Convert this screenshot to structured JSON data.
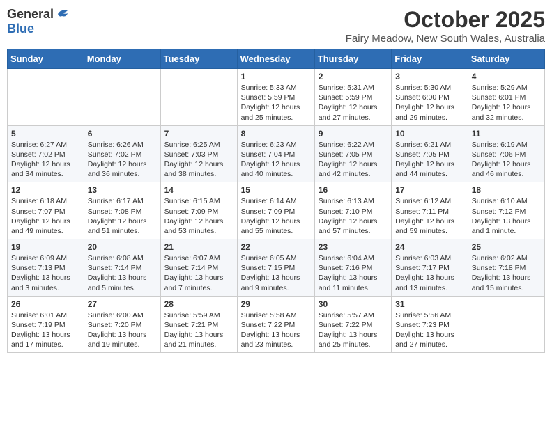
{
  "header": {
    "logo_general": "General",
    "logo_blue": "Blue",
    "month": "October 2025",
    "location": "Fairy Meadow, New South Wales, Australia"
  },
  "days_of_week": [
    "Sunday",
    "Monday",
    "Tuesday",
    "Wednesday",
    "Thursday",
    "Friday",
    "Saturday"
  ],
  "weeks": [
    [
      {
        "day": "",
        "info": ""
      },
      {
        "day": "",
        "info": ""
      },
      {
        "day": "",
        "info": ""
      },
      {
        "day": "1",
        "info": "Sunrise: 5:33 AM\nSunset: 5:59 PM\nDaylight: 12 hours\nand 25 minutes."
      },
      {
        "day": "2",
        "info": "Sunrise: 5:31 AM\nSunset: 5:59 PM\nDaylight: 12 hours\nand 27 minutes."
      },
      {
        "day": "3",
        "info": "Sunrise: 5:30 AM\nSunset: 6:00 PM\nDaylight: 12 hours\nand 29 minutes."
      },
      {
        "day": "4",
        "info": "Sunrise: 5:29 AM\nSunset: 6:01 PM\nDaylight: 12 hours\nand 32 minutes."
      }
    ],
    [
      {
        "day": "5",
        "info": "Sunrise: 6:27 AM\nSunset: 7:02 PM\nDaylight: 12 hours\nand 34 minutes."
      },
      {
        "day": "6",
        "info": "Sunrise: 6:26 AM\nSunset: 7:02 PM\nDaylight: 12 hours\nand 36 minutes."
      },
      {
        "day": "7",
        "info": "Sunrise: 6:25 AM\nSunset: 7:03 PM\nDaylight: 12 hours\nand 38 minutes."
      },
      {
        "day": "8",
        "info": "Sunrise: 6:23 AM\nSunset: 7:04 PM\nDaylight: 12 hours\nand 40 minutes."
      },
      {
        "day": "9",
        "info": "Sunrise: 6:22 AM\nSunset: 7:05 PM\nDaylight: 12 hours\nand 42 minutes."
      },
      {
        "day": "10",
        "info": "Sunrise: 6:21 AM\nSunset: 7:05 PM\nDaylight: 12 hours\nand 44 minutes."
      },
      {
        "day": "11",
        "info": "Sunrise: 6:19 AM\nSunset: 7:06 PM\nDaylight: 12 hours\nand 46 minutes."
      }
    ],
    [
      {
        "day": "12",
        "info": "Sunrise: 6:18 AM\nSunset: 7:07 PM\nDaylight: 12 hours\nand 49 minutes."
      },
      {
        "day": "13",
        "info": "Sunrise: 6:17 AM\nSunset: 7:08 PM\nDaylight: 12 hours\nand 51 minutes."
      },
      {
        "day": "14",
        "info": "Sunrise: 6:15 AM\nSunset: 7:09 PM\nDaylight: 12 hours\nand 53 minutes."
      },
      {
        "day": "15",
        "info": "Sunrise: 6:14 AM\nSunset: 7:09 PM\nDaylight: 12 hours\nand 55 minutes."
      },
      {
        "day": "16",
        "info": "Sunrise: 6:13 AM\nSunset: 7:10 PM\nDaylight: 12 hours\nand 57 minutes."
      },
      {
        "day": "17",
        "info": "Sunrise: 6:12 AM\nSunset: 7:11 PM\nDaylight: 12 hours\nand 59 minutes."
      },
      {
        "day": "18",
        "info": "Sunrise: 6:10 AM\nSunset: 7:12 PM\nDaylight: 13 hours\nand 1 minute."
      }
    ],
    [
      {
        "day": "19",
        "info": "Sunrise: 6:09 AM\nSunset: 7:13 PM\nDaylight: 13 hours\nand 3 minutes."
      },
      {
        "day": "20",
        "info": "Sunrise: 6:08 AM\nSunset: 7:14 PM\nDaylight: 13 hours\nand 5 minutes."
      },
      {
        "day": "21",
        "info": "Sunrise: 6:07 AM\nSunset: 7:14 PM\nDaylight: 13 hours\nand 7 minutes."
      },
      {
        "day": "22",
        "info": "Sunrise: 6:05 AM\nSunset: 7:15 PM\nDaylight: 13 hours\nand 9 minutes."
      },
      {
        "day": "23",
        "info": "Sunrise: 6:04 AM\nSunset: 7:16 PM\nDaylight: 13 hours\nand 11 minutes."
      },
      {
        "day": "24",
        "info": "Sunrise: 6:03 AM\nSunset: 7:17 PM\nDaylight: 13 hours\nand 13 minutes."
      },
      {
        "day": "25",
        "info": "Sunrise: 6:02 AM\nSunset: 7:18 PM\nDaylight: 13 hours\nand 15 minutes."
      }
    ],
    [
      {
        "day": "26",
        "info": "Sunrise: 6:01 AM\nSunset: 7:19 PM\nDaylight: 13 hours\nand 17 minutes."
      },
      {
        "day": "27",
        "info": "Sunrise: 6:00 AM\nSunset: 7:20 PM\nDaylight: 13 hours\nand 19 minutes."
      },
      {
        "day": "28",
        "info": "Sunrise: 5:59 AM\nSunset: 7:21 PM\nDaylight: 13 hours\nand 21 minutes."
      },
      {
        "day": "29",
        "info": "Sunrise: 5:58 AM\nSunset: 7:22 PM\nDaylight: 13 hours\nand 23 minutes."
      },
      {
        "day": "30",
        "info": "Sunrise: 5:57 AM\nSunset: 7:22 PM\nDaylight: 13 hours\nand 25 minutes."
      },
      {
        "day": "31",
        "info": "Sunrise: 5:56 AM\nSunset: 7:23 PM\nDaylight: 13 hours\nand 27 minutes."
      },
      {
        "day": "",
        "info": ""
      }
    ]
  ]
}
